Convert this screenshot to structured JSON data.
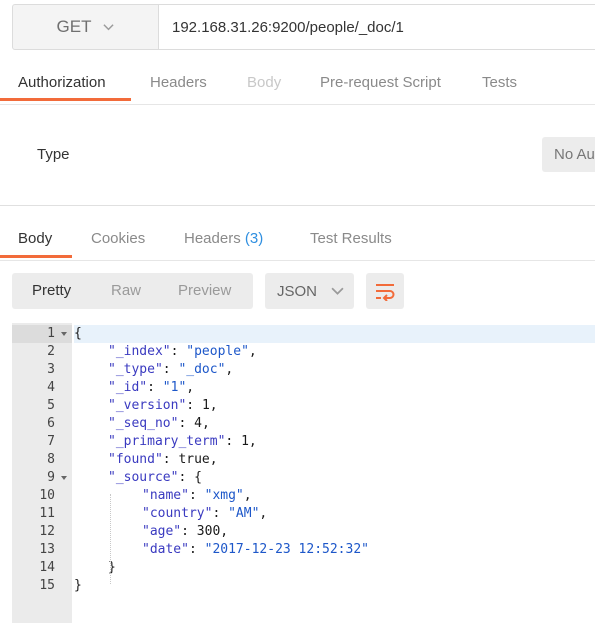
{
  "request": {
    "method": "GET",
    "url": "192.168.31.26:9200/people/_doc/1"
  },
  "request_tabs": [
    {
      "label": "Authorization",
      "active": true
    },
    {
      "label": "Headers"
    },
    {
      "label": "Body",
      "disabled": true
    },
    {
      "label": "Pre-request Script"
    },
    {
      "label": "Tests"
    }
  ],
  "auth": {
    "type_label": "Type",
    "type_value": "No Auth"
  },
  "response_tabs": [
    {
      "label": "Body",
      "active": true
    },
    {
      "label": "Cookies"
    },
    {
      "label": "Headers",
      "count": "(3)"
    },
    {
      "label": "Test Results"
    }
  ],
  "view_modes": [
    "Pretty",
    "Raw",
    "Preview"
  ],
  "format": "JSON",
  "icons": {
    "method_dropdown": "chevron-down-icon",
    "format_dropdown": "chevron-down-icon",
    "wrap": "wrap-lines-icon",
    "fold": "fold-arrow-icon"
  },
  "colors": {
    "accent": "#f26b3a",
    "link": "#2f8fe0",
    "json_string": "#1d57c9",
    "json_key": "#3a3ac0"
  },
  "code_lines": [
    {
      "num": "1",
      "fold": true,
      "active": true,
      "tokens": [
        {
          "t": "p",
          "v": "{"
        }
      ]
    },
    {
      "num": "2",
      "tokens": [
        {
          "t": "k",
          "v": "\"_index\""
        },
        {
          "t": "p",
          "v": ": "
        },
        {
          "t": "s",
          "v": "\"people\""
        },
        {
          "t": "p",
          "v": ","
        }
      ]
    },
    {
      "num": "3",
      "tokens": [
        {
          "t": "k",
          "v": "\"_type\""
        },
        {
          "t": "p",
          "v": ": "
        },
        {
          "t": "s",
          "v": "\"_doc\""
        },
        {
          "t": "p",
          "v": ","
        }
      ]
    },
    {
      "num": "4",
      "tokens": [
        {
          "t": "k",
          "v": "\"_id\""
        },
        {
          "t": "p",
          "v": ": "
        },
        {
          "t": "s",
          "v": "\"1\""
        },
        {
          "t": "p",
          "v": ","
        }
      ]
    },
    {
      "num": "5",
      "tokens": [
        {
          "t": "k",
          "v": "\"_version\""
        },
        {
          "t": "p",
          "v": ": "
        },
        {
          "t": "l",
          "v": "1"
        },
        {
          "t": "p",
          "v": ","
        }
      ]
    },
    {
      "num": "6",
      "tokens": [
        {
          "t": "k",
          "v": "\"_seq_no\""
        },
        {
          "t": "p",
          "v": ": "
        },
        {
          "t": "l",
          "v": "4"
        },
        {
          "t": "p",
          "v": ","
        }
      ]
    },
    {
      "num": "7",
      "tokens": [
        {
          "t": "k",
          "v": "\"_primary_term\""
        },
        {
          "t": "p",
          "v": ": "
        },
        {
          "t": "l",
          "v": "1"
        },
        {
          "t": "p",
          "v": ","
        }
      ]
    },
    {
      "num": "8",
      "tokens": [
        {
          "t": "k",
          "v": "\"found\""
        },
        {
          "t": "p",
          "v": ": "
        },
        {
          "t": "l",
          "v": "true"
        },
        {
          "t": "p",
          "v": ","
        }
      ]
    },
    {
      "num": "9",
      "fold": true,
      "tokens": [
        {
          "t": "k",
          "v": "\"_source\""
        },
        {
          "t": "p",
          "v": ": {"
        }
      ]
    },
    {
      "num": "10",
      "tokens": [
        {
          "t": "k",
          "v": "\"name\""
        },
        {
          "t": "p",
          "v": ": "
        },
        {
          "t": "s",
          "v": "\"xmg\""
        },
        {
          "t": "p",
          "v": ","
        }
      ]
    },
    {
      "num": "11",
      "tokens": [
        {
          "t": "k",
          "v": "\"country\""
        },
        {
          "t": "p",
          "v": ": "
        },
        {
          "t": "s",
          "v": "\"AM\""
        },
        {
          "t": "p",
          "v": ","
        }
      ]
    },
    {
      "num": "12",
      "tokens": [
        {
          "t": "k",
          "v": "\"age\""
        },
        {
          "t": "p",
          "v": ": "
        },
        {
          "t": "l",
          "v": "300"
        },
        {
          "t": "p",
          "v": ","
        }
      ]
    },
    {
      "num": "13",
      "tokens": [
        {
          "t": "k",
          "v": "\"date\""
        },
        {
          "t": "p",
          "v": ": "
        },
        {
          "t": "s",
          "v": "\"2017-12-23 12:52:32\""
        }
      ]
    },
    {
      "num": "14",
      "tokens": [
        {
          "t": "p",
          "v": "}"
        }
      ]
    },
    {
      "num": "15",
      "tokens": [
        {
          "t": "p",
          "v": "}"
        }
      ]
    }
  ]
}
